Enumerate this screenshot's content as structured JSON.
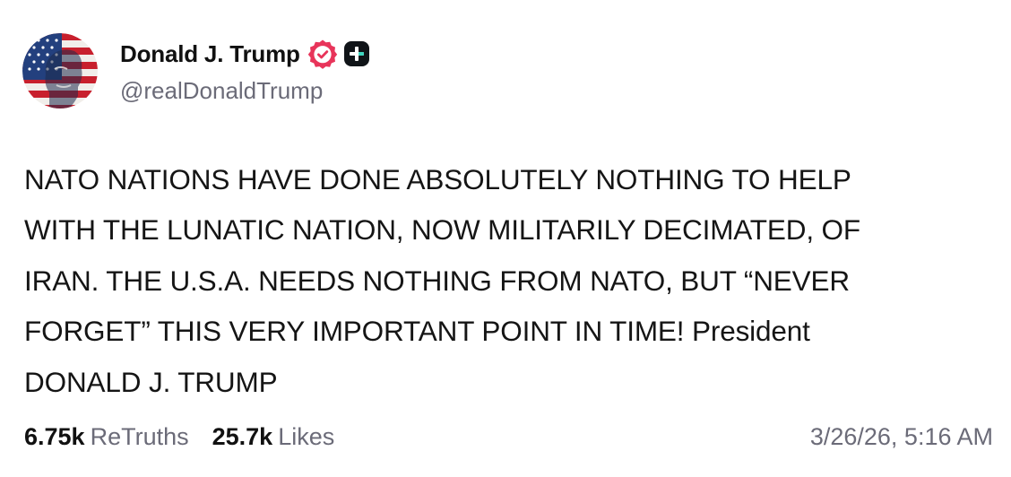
{
  "author": {
    "display_name": "Donald J. Trump",
    "handle": "@realDonaldTrump",
    "verified_icon": "verified-badge-icon",
    "badge_icon": "plus-badge-icon"
  },
  "post": {
    "text": "NATO NATIONS HAVE DONE ABSOLUTELY NOTHING TO HELP\nWITH THE LUNATIC NATION, NOW MILITARILY DECIMATED, OF\nIRAN. THE U.S.A. NEEDS NOTHING FROM NATO, BUT “NEVER\nFORGET” THIS VERY IMPORTANT POINT IN TIME! President\nDONALD J. TRUMP"
  },
  "stats": {
    "retruths_count": "6.75k",
    "retruths_label": "ReTruths",
    "likes_count": "25.7k",
    "likes_label": "Likes"
  },
  "timestamp": "3/26/26, 5:16 AM",
  "colors": {
    "text": "#111111",
    "muted": "#6b6b78",
    "verified_badge": "#e8345a",
    "plus_badge": "#101418"
  }
}
